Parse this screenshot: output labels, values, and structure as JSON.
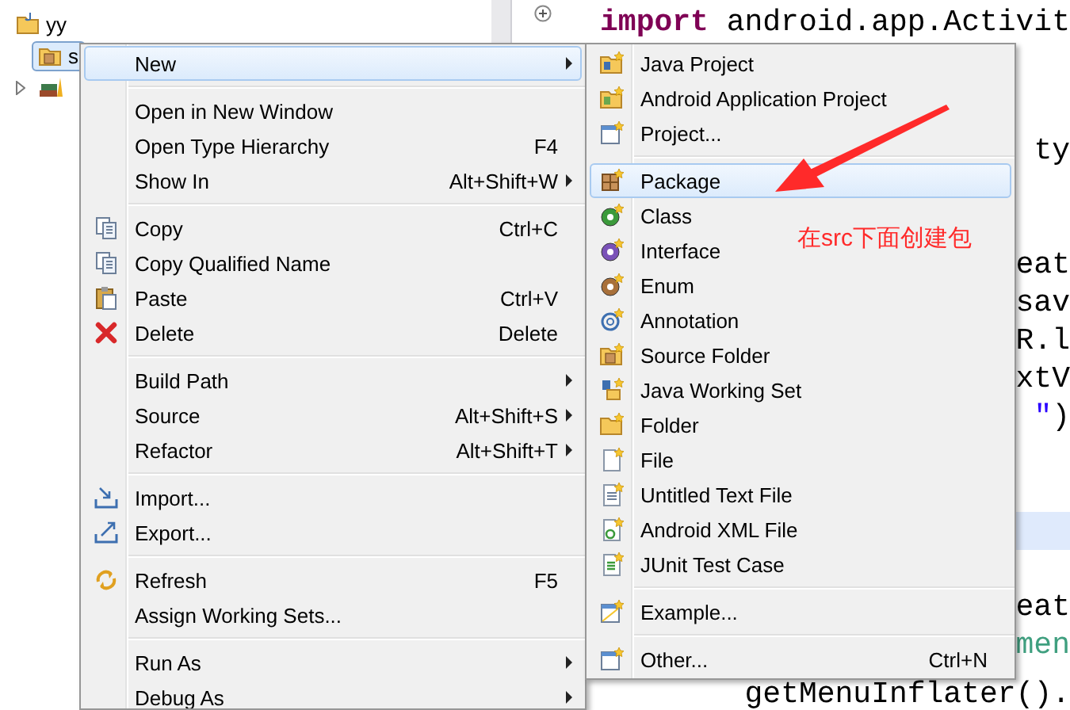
{
  "project_tree": {
    "items": [
      {
        "label": "yy",
        "selected": false,
        "children": [
          {
            "label": "s",
            "selected": true,
            "expander_shown": false
          },
          {
            "selected": false,
            "expander_shown": true
          }
        ]
      }
    ]
  },
  "editor": {
    "lines": [
      {
        "current": false,
        "segments": [
          {
            "text": "import",
            "kind": "keyword"
          },
          {
            "text": " android.app.Activit",
            "kind": "plain"
          }
        ]
      },
      {
        "current": false
      },
      {
        "current": false
      },
      {
        "current": false,
        "segments": [
          {
            "text": "ty",
            "kind": "plain"
          }
        ]
      },
      {
        "current": false
      },
      {
        "current": false
      },
      {
        "current": false,
        "segments": [
          {
            "text": "eat",
            "kind": "plain"
          }
        ]
      },
      {
        "current": false,
        "segments": [
          {
            "text": "sav",
            "kind": "plain"
          }
        ]
      },
      {
        "current": false,
        "segments": [
          {
            "text": "R.l",
            "kind": "plain"
          }
        ]
      },
      {
        "current": false,
        "segments": [
          {
            "text": "xtV",
            "kind": "plain"
          }
        ]
      },
      {
        "current": false,
        "segments": [
          {
            "text": "\"",
            "kind": "string"
          },
          {
            "text": ")",
            "kind": "plain"
          }
        ]
      },
      {
        "current": false
      },
      {
        "current": false
      },
      {
        "current": true
      },
      {
        "current": false
      },
      {
        "current": false,
        "segments": [
          {
            "text": "eat",
            "kind": "plain"
          }
        ]
      },
      {
        "current": false,
        "segments": [
          {
            "text": "men",
            "kind": "comment"
          }
        ]
      },
      {
        "current": false,
        "segments": [
          {
            "text": "getMenuInflater().",
            "kind": "plain"
          }
        ]
      }
    ]
  },
  "context_menu": {
    "groups": [
      {
        "items": [
          {
            "label": "New",
            "selected": true,
            "has_submenu": true
          }
        ]
      },
      {
        "items": [
          {
            "label": "Open in New Window",
            "selected": false,
            "has_submenu": false
          },
          {
            "label": "Open Type Hierarchy",
            "shortcut": "F4",
            "selected": false,
            "has_submenu": false
          },
          {
            "label": "Show In",
            "shortcut": "Alt+Shift+W",
            "selected": false,
            "has_submenu": true
          }
        ]
      },
      {
        "items": [
          {
            "label": "Copy",
            "shortcut": "Ctrl+C",
            "selected": false,
            "has_submenu": false
          },
          {
            "label": "Copy Qualified Name",
            "selected": false,
            "has_submenu": false
          },
          {
            "label": "Paste",
            "shortcut": "Ctrl+V",
            "selected": false,
            "has_submenu": false
          },
          {
            "label": "Delete",
            "shortcut": "Delete",
            "selected": false,
            "has_submenu": false
          }
        ]
      },
      {
        "items": [
          {
            "label": "Build Path",
            "selected": false,
            "has_submenu": true
          },
          {
            "label": "Source",
            "shortcut": "Alt+Shift+S",
            "selected": false,
            "has_submenu": true
          },
          {
            "label": "Refactor",
            "shortcut": "Alt+Shift+T",
            "selected": false,
            "has_submenu": true
          }
        ]
      },
      {
        "items": [
          {
            "label": "Import...",
            "selected": false,
            "has_submenu": false
          },
          {
            "label": "Export...",
            "selected": false,
            "has_submenu": false
          }
        ]
      },
      {
        "items": [
          {
            "label": "Refresh",
            "shortcut": "F5",
            "selected": false,
            "has_submenu": false
          },
          {
            "label": "Assign Working Sets...",
            "selected": false,
            "has_submenu": false
          }
        ]
      },
      {
        "items": [
          {
            "label": "Run As",
            "selected": false,
            "has_submenu": true
          },
          {
            "label": "Debug As",
            "selected": false,
            "has_submenu": true
          }
        ]
      }
    ]
  },
  "new_submenu": {
    "groups": [
      {
        "items": [
          {
            "label": "Java Project",
            "selected": false,
            "has_submenu": false
          },
          {
            "label": "Android Application Project",
            "selected": false,
            "has_submenu": false
          },
          {
            "label": "Project...",
            "selected": false,
            "has_submenu": false
          }
        ]
      },
      {
        "items": [
          {
            "label": "Package",
            "selected": true,
            "has_submenu": false
          },
          {
            "label": "Class",
            "selected": false,
            "has_submenu": false
          },
          {
            "label": "Interface",
            "selected": false,
            "has_submenu": false
          },
          {
            "label": "Enum",
            "selected": false,
            "has_submenu": false
          },
          {
            "label": "Annotation",
            "selected": false,
            "has_submenu": false
          },
          {
            "label": "Source Folder",
            "selected": false,
            "has_submenu": false
          },
          {
            "label": "Java Working Set",
            "selected": false,
            "has_submenu": false
          },
          {
            "label": "Folder",
            "selected": false,
            "has_submenu": false
          },
          {
            "label": "File",
            "selected": false,
            "has_submenu": false
          },
          {
            "label": "Untitled Text File",
            "selected": false,
            "has_submenu": false
          },
          {
            "label": "Android XML File",
            "selected": false,
            "has_submenu": false
          },
          {
            "label": "JUnit Test Case",
            "selected": false,
            "has_submenu": false
          }
        ]
      },
      {
        "items": [
          {
            "label": "Example...",
            "selected": false,
            "has_submenu": false
          }
        ]
      },
      {
        "items": [
          {
            "label": "Other...",
            "shortcut": "Ctrl+N",
            "selected": false,
            "has_submenu": false
          }
        ]
      }
    ]
  },
  "annotation": {
    "text": "在src下面创建包"
  }
}
